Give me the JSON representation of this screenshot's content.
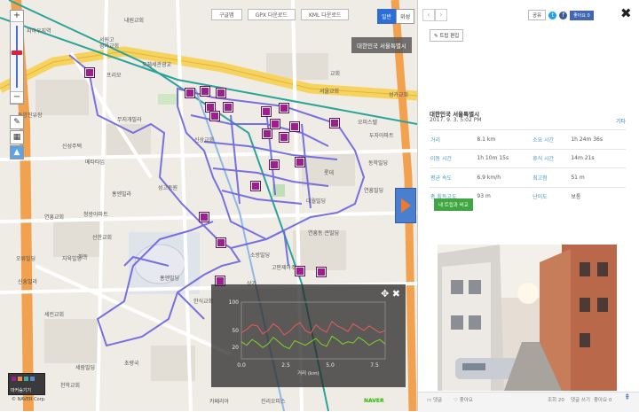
{
  "map": {
    "top_buttons": [
      "구글맵",
      "GPX 다운로드",
      "KML 다운로드"
    ],
    "lang": {
      "active": "일반",
      "inactive": "위성"
    },
    "region_badge": "대한민국 서울특별시",
    "zoom": {
      "plus": "+",
      "minus": "−"
    },
    "labels": [
      "내원교회",
      "지하우지역",
      "서원고",
      "성가교회",
      "프리모",
      "오체세관광교",
      "동양진유장",
      "무지개빌라",
      "신성주택",
      "메타타임",
      "홍엔빌라",
      "연흥교회",
      "청방아파트",
      "선한교회",
      "오류빌딩",
      "자육빌딩",
      "신흥빌라",
      "홍엔빌딩",
      "상가",
      "소방빌딩",
      "성고동원",
      "신상교회",
      "교회",
      "서울교회",
      "성가교회",
      "두자아파트",
      "오피스텔",
      "동학빌딩",
      "롯데",
      "연흥빌딩",
      "대월빌딩",
      "연흥동 큰빌딩",
      "고판제아주",
      "한식교회",
      "파동",
      "세린교회",
      "세람빌딩",
      "초량국",
      "천학교회",
      "진리오피스",
      "카페리아"
    ],
    "legend_label": "마커숨기기",
    "copyright": "© NAVER Corp.",
    "naver_logo": "NAVER"
  },
  "chart_data": {
    "type": "line",
    "xlabel": "거리 (km)",
    "x_ticks": [
      "0.0",
      "2.5",
      "5.0",
      "7.5"
    ],
    "y_ticks": [
      "100",
      "50",
      "20"
    ],
    "x": [
      0,
      0.3,
      0.6,
      0.9,
      1.2,
      1.5,
      1.8,
      2.1,
      2.4,
      2.7,
      3.0,
      3.3,
      3.6,
      3.9,
      4.2,
      4.5,
      4.8,
      5.1,
      5.4,
      5.7,
      6.0,
      6.3,
      6.6,
      6.9,
      7.2,
      7.5,
      7.8,
      8.1
    ],
    "series": [
      {
        "color": "#e85a5a",
        "values": [
          46,
          52,
          60,
          58,
          44,
          50,
          62,
          55,
          42,
          48,
          58,
          64,
          50,
          45,
          60,
          52,
          47,
          66,
          58,
          54,
          48,
          62,
          56,
          50,
          58,
          52,
          46,
          50
        ]
      },
      {
        "color": "#7ed321",
        "values": [
          30,
          24,
          34,
          28,
          20,
          26,
          38,
          30,
          22,
          18,
          32,
          28,
          24,
          30,
          36,
          26,
          22,
          40,
          34,
          26,
          30,
          28,
          38,
          32,
          24,
          30,
          34,
          26
        ]
      }
    ],
    "xlim": [
      0,
      8.1
    ],
    "ylim": [
      0,
      100
    ]
  },
  "side": {
    "share_label": "공유",
    "like_label": "좋아요 0",
    "close": "✖",
    "edit_label": "트립 편집",
    "trip_name": "대한민국 서울특별시",
    "trip_date": "2017. 9. 3. 5:02 PM",
    "etc": "기타",
    "stats": [
      {
        "k1": "거리",
        "v1": "8.1 km",
        "k2": "소요 시간",
        "v2": "1h 24m 36s"
      },
      {
        "k1": "이동 시간",
        "v1": "1h 10m 15s",
        "k2": "휴식 시간",
        "v2": "14m 21s"
      },
      {
        "k1": "평균 속도",
        "v1": "6.9 km/h",
        "k2": "최고점",
        "v2": "51 m"
      },
      {
        "k1": "총 획득고도",
        "v1": "93 m",
        "k2": "난이도",
        "v2": "보통"
      }
    ],
    "compare_button": "내 트립과 비교",
    "footer": [
      "댓글",
      "좋아요",
      "조회 20",
      "댓글 쓰기",
      "좋아요 0"
    ]
  }
}
